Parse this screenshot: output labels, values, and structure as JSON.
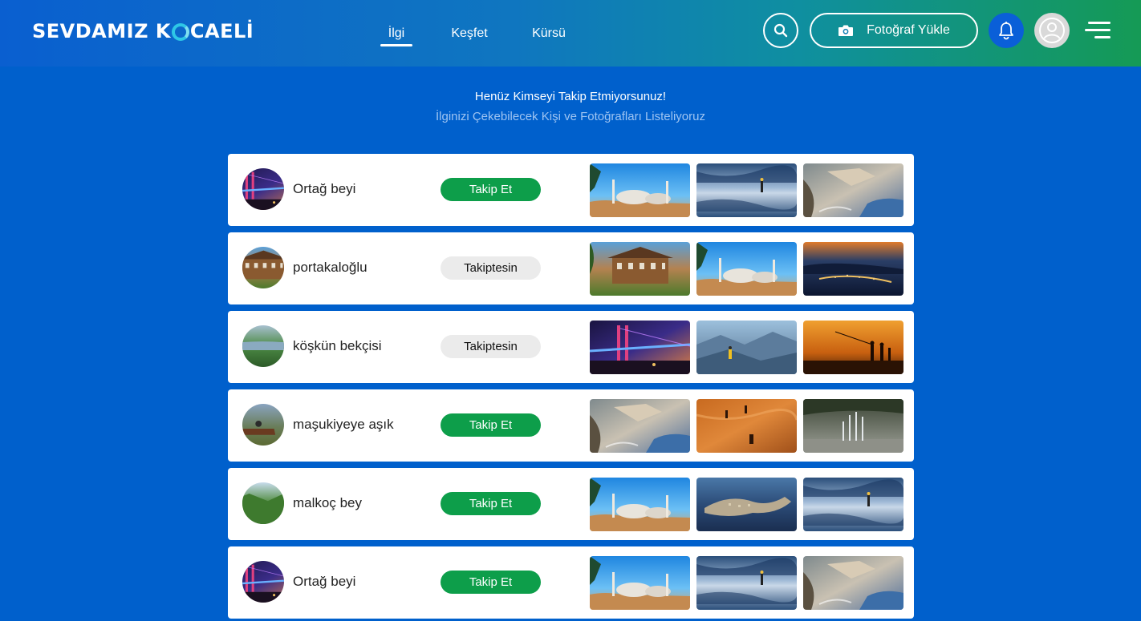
{
  "header": {
    "logo_left": "SEVDAMIZ K",
    "logo_right": "CAELİ",
    "nav": [
      {
        "label": "İlgi",
        "active": true
      },
      {
        "label": "Keşfet",
        "active": false
      },
      {
        "label": "Kürsü",
        "active": false
      }
    ],
    "upload_label": "Fotoğraf Yükle",
    "icons": {
      "search": "search-icon",
      "camera": "camera-icon",
      "bell": "bell-icon",
      "avatar": "user-avatar-icon",
      "menu": "hamburger-menu-icon"
    }
  },
  "intro": {
    "title": "Henüz Kimseyi Takip Etmiyorsunuz!",
    "subtitle": "İlginizi Çekebilecek Kişi ve Fotoğrafları Listeliyoruz"
  },
  "colors": {
    "page_background": "#0060cc",
    "follow_button": "#0d9e4a",
    "following_button": "#ebebeb"
  },
  "users": [
    {
      "name": "Ortağ beyi",
      "button": "Takip Et",
      "following": false,
      "avatar": "bridge-night",
      "photos": [
        "mosque-blue-sky",
        "lake-reflection",
        "rock-coast"
      ]
    },
    {
      "name": "portakaloğlu",
      "button": "Takiptesin",
      "following": true,
      "avatar": "wooden-mansion",
      "photos": [
        "wooden-mansion",
        "mosque-blue-sky",
        "city-night-bay"
      ]
    },
    {
      "name": "köşkün bekçisi",
      "button": "Takiptesin",
      "following": true,
      "avatar": "green-lake",
      "photos": [
        "bridge-night",
        "mountain-hiker",
        "sunset-fishermen"
      ]
    },
    {
      "name": "maşukiyeye aşık",
      "button": "Takip Et",
      "following": false,
      "avatar": "horse-rider",
      "photos": [
        "rock-coast",
        "desert-walkers",
        "fountain-park"
      ]
    },
    {
      "name": "malkoç bey",
      "button": "Takip Et",
      "following": false,
      "avatar": "green-mountains",
      "photos": [
        "mosque-blue-sky",
        "aerial-peninsula",
        "lake-reflection"
      ]
    },
    {
      "name": "Ortağ beyi",
      "button": "Takip Et",
      "following": false,
      "avatar": "bridge-night",
      "photos": [
        "mosque-blue-sky",
        "lake-reflection",
        "rock-coast"
      ]
    }
  ]
}
